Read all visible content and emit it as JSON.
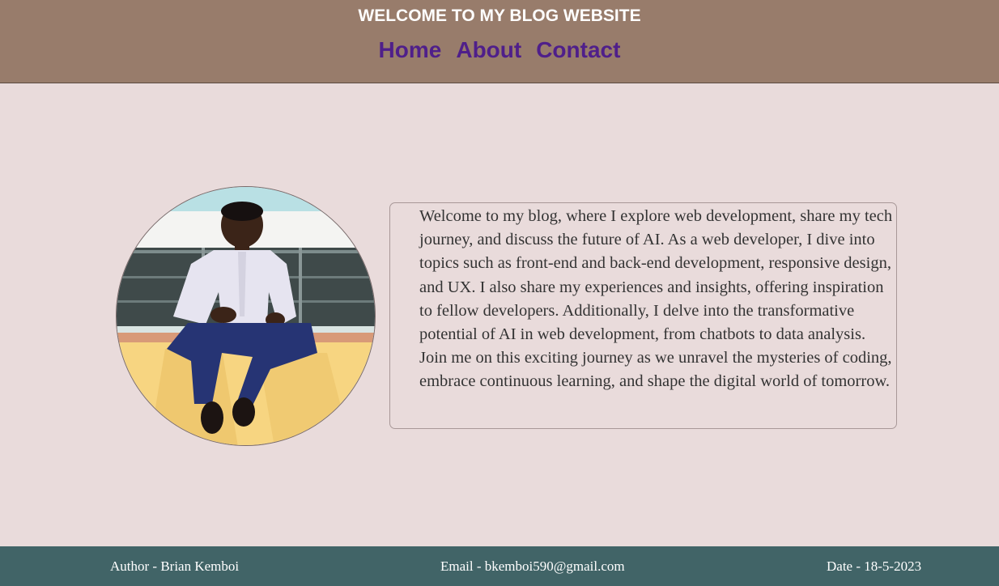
{
  "header": {
    "title": "WELCOME TO MY BLOG WEBSITE",
    "nav": [
      {
        "label": "Home"
      },
      {
        "label": "About"
      },
      {
        "label": "Contact"
      }
    ]
  },
  "main": {
    "about_text": "Welcome to my blog, where I explore web development, share my tech journey, and discuss the future of AI. As a web developer, I dive into topics such as front-end and back-end development, responsive design, and UX. I also share my experiences and insights, offering inspiration to fellow developers. Additionally, I delve into the transformative potential of AI in web development, from chatbots to data analysis. Join me on this exciting journey as we unravel the mysteries of coding, embrace continuous learning, and shape the digital world of tomorrow."
  },
  "footer": {
    "author": "Author - Brian Kemboi",
    "email": "Email - bkemboi590@gmail.com",
    "date": "Date - 18-5-2023"
  },
  "colors": {
    "header_bg": "#987c6b",
    "nav_link": "#4f1f8a",
    "page_bg": "#e9dbdb",
    "footer_bg": "#416467"
  }
}
